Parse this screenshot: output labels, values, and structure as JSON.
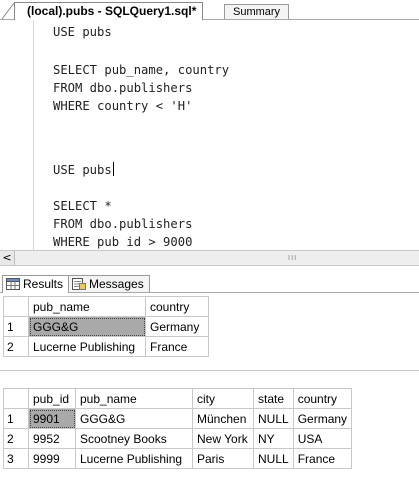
{
  "tabs": {
    "active": "(local).pubs - SQLQuery1.sql*",
    "inactive": "Summary"
  },
  "editor": {
    "lines": [
      "USE pubs",
      "",
      "SELECT pub_name, country",
      "FROM dbo.publishers",
      "WHERE country < 'H'",
      "",
      "",
      "USE pubs",
      "",
      "SELECT *",
      "FROM dbo.publishers",
      "WHERE pub id > 9000"
    ]
  },
  "scrollbar": {
    "left_arrow": "<",
    "grip": "III"
  },
  "results_tabs": {
    "results": "Results",
    "messages": "Messages"
  },
  "grid1": {
    "columns": [
      "",
      "pub_name",
      "country"
    ],
    "rows": [
      [
        "1",
        "GGG&G",
        "Germany"
      ],
      [
        "2",
        "Lucerne Publishing",
        "France"
      ]
    ]
  },
  "grid2": {
    "columns": [
      "",
      "pub_id",
      "pub_name",
      "city",
      "state",
      "country"
    ],
    "rows": [
      [
        "1",
        "9901",
        "GGG&G",
        "München",
        "NULL",
        "Germany"
      ],
      [
        "2",
        "9952",
        "Scootney Books",
        "New York",
        "NY",
        "USA"
      ],
      [
        "3",
        "9999",
        "Lucerne Publishing",
        "Paris",
        "NULL",
        "France"
      ]
    ]
  }
}
